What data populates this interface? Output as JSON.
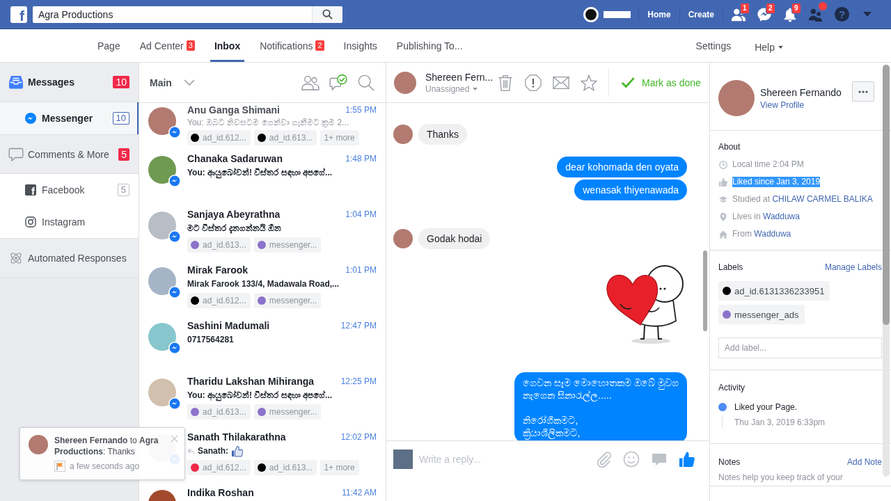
{
  "top_bar": {
    "logo": "f",
    "search": {
      "value": "Agra Productions"
    },
    "links": [
      "Home",
      "Create"
    ],
    "icon_badges": [
      "1",
      "2",
      "9"
    ],
    "alert_dot": true,
    "help_glyph": "?"
  },
  "page_nav": {
    "tabs": [
      {
        "label": "Page",
        "selected": false
      },
      {
        "label": "Ad Center",
        "badge": "3",
        "selected": false
      },
      {
        "label": "Inbox",
        "selected": true
      },
      {
        "label": "Notifications",
        "badge": "2",
        "selected": false
      },
      {
        "label": "Insights",
        "selected": false
      },
      {
        "label": "Publishing To...",
        "selected": false
      }
    ],
    "right": [
      {
        "label": "Settings",
        "menu": false
      },
      {
        "label": "Help",
        "menu": true
      }
    ]
  },
  "sidebar": {
    "sections": [
      {
        "label": "Messages",
        "badge": "10",
        "selected": true,
        "children": [
          {
            "label": "Messenger",
            "badge": "10",
            "selected": true
          }
        ]
      },
      {
        "label": "Comments & More",
        "badge": "5",
        "selected": false,
        "children": [
          {
            "label": "Facebook",
            "badge": "5",
            "glyph": "f",
            "selected": false
          },
          {
            "label": "Instagram",
            "selected": false
          }
        ]
      },
      {
        "label": "Automated Responses",
        "selected": false
      }
    ]
  },
  "conversation_list": {
    "folder": "Main",
    "conversations": [
      {
        "kind": "text",
        "name": "Anu Ganga Shimani",
        "time": "1:55 PM",
        "preview": "You: ඔබට නිවසටම ගෙන්වා ගැනීමට ක්‍රම 2...",
        "unread": false,
        "tags": [
          {
            "kind": "label",
            "text": "ad_id.612...",
            "color": "#000000"
          },
          {
            "kind": "label",
            "text": "ad_id.613...",
            "color": "#000000"
          },
          {
            "kind": "more",
            "text": "1+ more"
          }
        ]
      },
      {
        "kind": "text",
        "name": "Chanaka Sadaruwan",
        "time": "1:48 PM",
        "preview": "You: ආයුබෝවන්! විස්තර සඳහා අපගේ...",
        "unread": true
      },
      {
        "kind": "text",
        "name": "Sanjaya Abeyrathna",
        "time": "1:04 PM",
        "preview": "මට විස්තර දැනගන්නයි ඕන",
        "unread": true,
        "tags": [
          {
            "kind": "label",
            "text": "ad_id.613...",
            "color": "#8c72cb"
          },
          {
            "kind": "label",
            "text": "messenger...",
            "color": "#8c72cb"
          }
        ]
      },
      {
        "kind": "text",
        "name": "Mirak Farook",
        "time": "1:01 PM",
        "preview": "Mirak Farook 133/4, Madawala Road,...",
        "unread": true,
        "tags": [
          {
            "kind": "label",
            "text": "ad_id.612...",
            "color": "#000000"
          },
          {
            "kind": "label",
            "text": "messenger...",
            "color": "#8c72cb"
          }
        ]
      },
      {
        "kind": "text",
        "name": "Sashini Madumali",
        "time": "12:47 PM",
        "preview": "0717564281",
        "unread": true
      },
      {
        "kind": "text",
        "name": "Tharidu Lakshan Mihiranga",
        "time": "12:25 PM",
        "preview": "You: ආයුබෝවන්! විස්තර සඳහා අපගේ...",
        "unread": true,
        "tags": [
          {
            "kind": "label",
            "text": "ad_id.613...",
            "color": "#8c72cb"
          },
          {
            "kind": "label",
            "text": "messenger...",
            "color": "#8c72cb"
          }
        ]
      },
      {
        "kind": "reaction",
        "name": "Sanath Thilakarathna",
        "time": "12:02 PM",
        "preview": "Sanath:",
        "unread": true,
        "tags": [
          {
            "kind": "label",
            "text": "ad_id.612...",
            "color": "#f02849"
          },
          {
            "kind": "label",
            "text": "ad_id.613...",
            "color": "#000000"
          },
          {
            "kind": "more",
            "text": "1+ more"
          }
        ]
      },
      {
        "kind": "text",
        "name": "Indika Roshan",
        "time": "11:42 AM",
        "unread": true
      }
    ]
  },
  "chat": {
    "contact": "Shereen Fern...",
    "assignee": "Unassigned",
    "done_action": "Mark as done",
    "messages": [
      {
        "kind": "incoming",
        "text": "Thanks"
      },
      {
        "kind": "outgoing",
        "text": "dear kohomada den oyata"
      },
      {
        "kind": "outgoing",
        "text": "wenasak thiyenawada"
      },
      {
        "kind": "incoming",
        "text": "Godak hodai"
      },
      {
        "kind": "sticker"
      },
      {
        "kind": "outgoing",
        "text": "ගෙවන සෑම මොහොතකම ඔබේ මුවග\nනැගෙන සිනාරැල්ල.....\n\nනිරෝගීකමට,\nක්‍රියාශීලිකමට,"
      }
    ],
    "composer": {
      "placeholder": "Write a reply..."
    }
  },
  "contact_panel": {
    "name": "Shereen Fernando",
    "profile_link": "View Profile",
    "about": {
      "title": "About",
      "rows": [
        {
          "text": "Local time 2:04 PM",
          "highlighted": false
        },
        {
          "text": "Liked since Jan 3, 2019",
          "highlighted": true
        },
        {
          "text": "Studied at",
          "link": "CHILAW CARMEL BALIKA",
          "highlighted": false
        },
        {
          "text": "Lives in",
          "link": "Wadduwa",
          "highlighted": false
        },
        {
          "text": "From",
          "link": "Wadduwa",
          "highlighted": false
        }
      ]
    },
    "labels": {
      "title": "Labels",
      "action": "Manage Labels",
      "items": [
        {
          "text": "ad_id.6131336233951",
          "color": "#000000"
        },
        {
          "text": "messenger_ads",
          "color": "#8c72cb"
        }
      ],
      "placeholder": "Add label..."
    },
    "activity": {
      "title": "Activity",
      "items": [
        {
          "text": "Liked your Page.",
          "time": "Thu Jan 3, 2019 6:33pm"
        }
      ]
    },
    "notes": {
      "title": "Notes",
      "action": "Add Note",
      "hint": "Notes help you keep track of your"
    }
  },
  "toast": {
    "text": "**Shereen Fernando** to **Agra Productions**: Thanks",
    "time": "a few seconds ago"
  }
}
